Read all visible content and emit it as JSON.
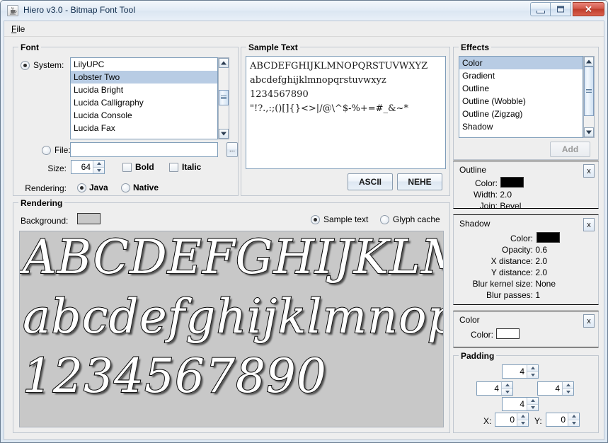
{
  "window": {
    "title": "Hiero v3.0 - Bitmap Font Tool",
    "icon": "java-coffee-cup-icon",
    "minimize_label": "",
    "maximize_label": "",
    "close_label": "✕"
  },
  "menubar": {
    "items": [
      {
        "label": "File",
        "mnemonic": "F"
      }
    ]
  },
  "font_panel": {
    "title": "Font",
    "system_radio_label": "System:",
    "system_selected": true,
    "font_list": [
      {
        "name": "LilyUPC",
        "selected": false
      },
      {
        "name": "Lobster Two",
        "selected": true
      },
      {
        "name": "Lucida Bright",
        "selected": false
      },
      {
        "name": "Lucida Calligraphy",
        "selected": false
      },
      {
        "name": "Lucida Console",
        "selected": false
      },
      {
        "name": "Lucida Fax",
        "selected": false
      }
    ],
    "file_radio_label": "File:",
    "file_selected": false,
    "file_value": "",
    "browse_label": "...",
    "size_label": "Size:",
    "size_value": "64",
    "bold_label": "Bold",
    "bold_checked": false,
    "italic_label": "Italic",
    "italic_checked": false,
    "rendering_label": "Rendering:",
    "rendering_options": [
      {
        "label": "Java",
        "selected": true
      },
      {
        "label": "Native",
        "selected": false
      }
    ]
  },
  "sample_panel": {
    "title": "Sample Text",
    "lines": [
      "ABCDEFGHIJKLMNOPQRSTUVWXYZ",
      "abcdefghijklmnopqrstuvwxyz",
      "1234567890",
      "\"!?.,:;()[]{}<>|/@\\^$-%+=#_&~*"
    ],
    "ascii_button": "ASCII",
    "nehe_button": "NEHE"
  },
  "effects_panel": {
    "title": "Effects",
    "list": [
      {
        "name": "Color",
        "selected": true
      },
      {
        "name": "Gradient",
        "selected": false
      },
      {
        "name": "Outline",
        "selected": false
      },
      {
        "name": "Outline (Wobble)",
        "selected": false
      },
      {
        "name": "Outline (Zigzag)",
        "selected": false
      },
      {
        "name": "Shadow",
        "selected": false
      }
    ],
    "add_button": "Add",
    "add_enabled": false
  },
  "applied_effects": [
    {
      "name": "Outline",
      "close_label": "x",
      "rows": [
        {
          "key": "Color:",
          "value": "",
          "swatch": "#000000"
        },
        {
          "key": "Width:",
          "value": "2.0"
        },
        {
          "key": "Join:",
          "value": "Bevel"
        }
      ]
    },
    {
      "name": "Shadow",
      "close_label": "x",
      "rows": [
        {
          "key": "Color:",
          "value": "",
          "swatch": "#000000"
        },
        {
          "key": "Opacity:",
          "value": "0.6"
        },
        {
          "key": "X distance:",
          "value": "2.0"
        },
        {
          "key": "Y distance:",
          "value": "2.0"
        },
        {
          "key": "Blur kernel size:",
          "value": "None"
        },
        {
          "key": "Blur passes:",
          "value": "1"
        }
      ]
    },
    {
      "name": "Color",
      "close_label": "x",
      "rows": [
        {
          "key": "Color:",
          "value": "",
          "swatch": "#ffffff"
        }
      ]
    }
  ],
  "padding_panel": {
    "title": "Padding",
    "top": "4",
    "left": "4",
    "right": "4",
    "bottom": "4",
    "x_label": "X:",
    "x_value": "0",
    "y_label": "Y:",
    "y_value": "0"
  },
  "rendering_panel": {
    "title": "Rendering",
    "background_label": "Background:",
    "background_color": "#c8c8c8",
    "view_options": [
      {
        "label": "Sample text",
        "selected": true
      },
      {
        "label": "Glyph cache",
        "selected": false
      }
    ],
    "preview_rows": [
      "ABCDEFGHIJKLMN",
      "abcdefghijklmnopqr",
      "1234567890"
    ]
  },
  "colors": {
    "panel_bg": "#eeeeee",
    "list_selection": "#b8cce4",
    "preview_bg": "#c8c8c8",
    "title_text": "#0d2a4a",
    "close_button": "#bf3d2b"
  }
}
